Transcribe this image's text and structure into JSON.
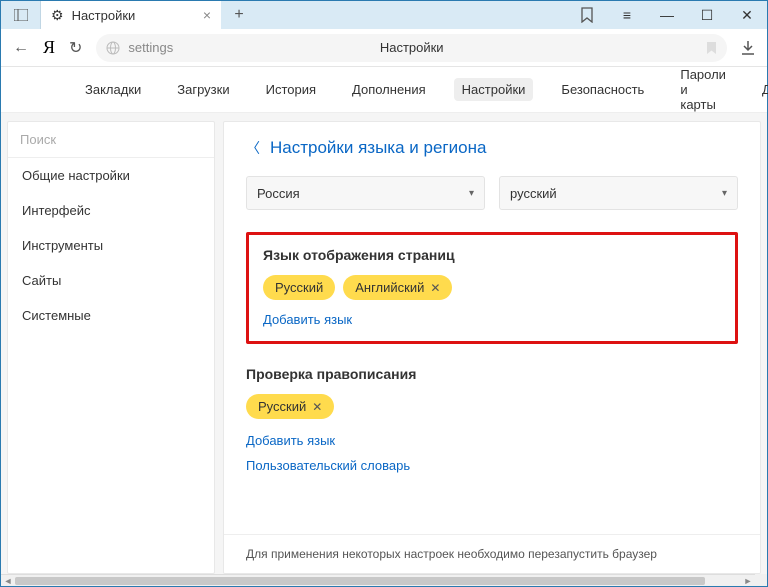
{
  "titlebar": {
    "tab_title": "Настройки",
    "close_glyph": "×",
    "new_tab_glyph": "+"
  },
  "win": {
    "bookmark": "⚐",
    "menu": "≡",
    "min": "—",
    "max": "☐",
    "close": "✕"
  },
  "toolbar": {
    "back": "←",
    "logo": "Я",
    "reload": "↻",
    "addr_text": "settings",
    "addr_title": "Настройки",
    "download": "⤓"
  },
  "topnav": {
    "items": [
      "Закладки",
      "Загрузки",
      "История",
      "Дополнения",
      "Настройки",
      "Безопасность",
      "Пароли и карты",
      "Други"
    ]
  },
  "sidebar": {
    "search_placeholder": "Поиск",
    "items": [
      "Общие настройки",
      "Интерфейс",
      "Инструменты",
      "Сайты",
      "Системные"
    ]
  },
  "main": {
    "header": "Настройки языка и региона",
    "region_select": "Россия",
    "lang_select": "русский",
    "page_lang": {
      "title": "Язык отображения страниц",
      "chips": [
        "Русский",
        "Английский"
      ],
      "add_link": "Добавить язык"
    },
    "spell": {
      "title": "Проверка правописания",
      "chips": [
        "Русский"
      ],
      "add_link": "Добавить язык",
      "dict_link": "Пользовательский словарь"
    },
    "footer": "Для применения некоторых настроек необходимо перезапустить браузер"
  }
}
